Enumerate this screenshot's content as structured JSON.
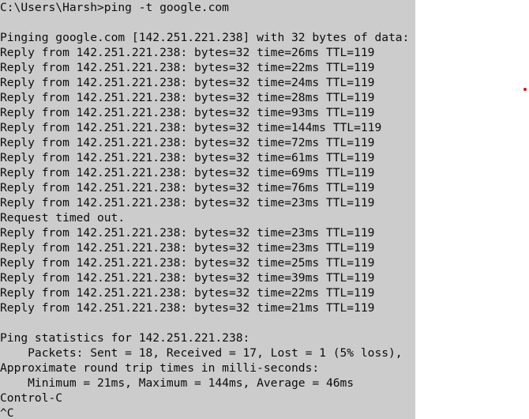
{
  "console": {
    "lines": [
      "C:\\Users\\Harsh>ping -t google.com",
      "",
      "Pinging google.com [142.251.221.238] with 32 bytes of data:",
      "Reply from 142.251.221.238: bytes=32 time=26ms TTL=119",
      "Reply from 142.251.221.238: bytes=32 time=22ms TTL=119",
      "Reply from 142.251.221.238: bytes=32 time=24ms TTL=119",
      "Reply from 142.251.221.238: bytes=32 time=28ms TTL=119",
      "Reply from 142.251.221.238: bytes=32 time=93ms TTL=119",
      "Reply from 142.251.221.238: bytes=32 time=144ms TTL=119",
      "Reply from 142.251.221.238: bytes=32 time=72ms TTL=119",
      "Reply from 142.251.221.238: bytes=32 time=61ms TTL=119",
      "Reply from 142.251.221.238: bytes=32 time=69ms TTL=119",
      "Reply from 142.251.221.238: bytes=32 time=76ms TTL=119",
      "Reply from 142.251.221.238: bytes=32 time=23ms TTL=119",
      "Request timed out.",
      "Reply from 142.251.221.238: bytes=32 time=23ms TTL=119",
      "Reply from 142.251.221.238: bytes=32 time=23ms TTL=119",
      "Reply from 142.251.221.238: bytes=32 time=25ms TTL=119",
      "Reply from 142.251.221.238: bytes=32 time=39ms TTL=119",
      "Reply from 142.251.221.238: bytes=32 time=22ms TTL=119",
      "Reply from 142.251.221.238: bytes=32 time=21ms TTL=119",
      "",
      "Ping statistics for 142.251.221.238:",
      "    Packets: Sent = 18, Received = 17, Lost = 1 (5% loss),",
      "Approximate round trip times in milli-seconds:",
      "    Minimum = 21ms, Maximum = 144ms, Average = 46ms",
      "Control-C",
      "^C"
    ]
  },
  "colors": {
    "console_background": "#cccccc",
    "console_text": "#0c0c0c",
    "page_background": "#ffffff",
    "marker": "#e01010"
  }
}
